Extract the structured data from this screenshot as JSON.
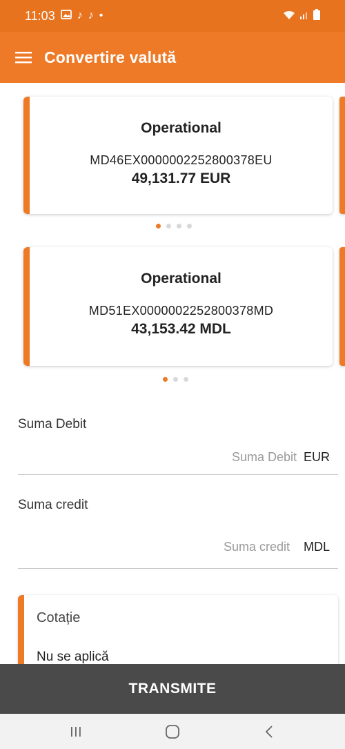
{
  "status_bar": {
    "time": "11:03",
    "notification_icons": [
      "gallery-icon",
      "tiktok-icon",
      "tiktok-icon",
      "dot-icon"
    ],
    "system_icons": [
      "wifi-icon",
      "signal-icon",
      "battery-icon"
    ]
  },
  "header": {
    "title": "Convertire valută",
    "menu_icon": "hamburger-menu-icon"
  },
  "accounts_debit": {
    "card": {
      "type": "Operational",
      "iban": "MD46EX0000002252800378EU",
      "balance": "49,131.77 EUR"
    },
    "pager": {
      "total": 4,
      "active": 1
    }
  },
  "accounts_credit": {
    "card": {
      "type": "Operational",
      "iban": "MD51EX0000002252800378MD",
      "balance": "43,153.42 MDL"
    },
    "pager": {
      "total": 3,
      "active": 1
    }
  },
  "form": {
    "debit": {
      "label": "Suma Debit",
      "placeholder": "Suma Debit",
      "value": "",
      "currency": "EUR"
    },
    "credit": {
      "label": "Suma credit",
      "placeholder": "Suma credit",
      "value": "",
      "currency": "MDL"
    }
  },
  "quote": {
    "title": "Cotație",
    "value": "Nu se aplică"
  },
  "submit": {
    "label": "TRANSMITE"
  },
  "system_nav": {
    "icons": [
      "recent-apps-icon",
      "home-icon",
      "back-icon"
    ]
  },
  "colors": {
    "accent": "#ee7a27",
    "status_bar": "#e8731f",
    "submit_bg": "#4a4a4a",
    "nav_bg": "#f2f2f2"
  }
}
